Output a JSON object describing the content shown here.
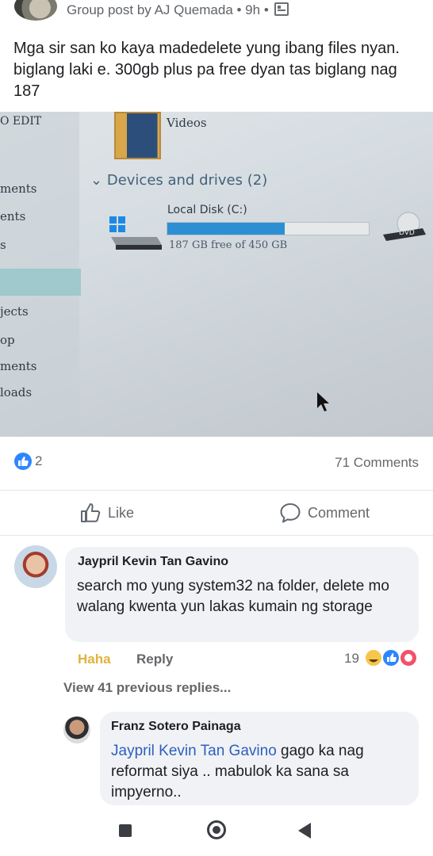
{
  "header": {
    "meta": "Group post by AJ Quemada • 9h •"
  },
  "post": {
    "text": "Mga sir san ko kaya madedelete yung ibang files nyan. biglang laki e. 300gb plus pa free dyan tas biglang nag 187"
  },
  "photo": {
    "edit_label": "O EDIT",
    "side_labels": [
      "ments",
      "ents",
      "s",
      "jects",
      "op",
      "ments",
      "loads"
    ],
    "videos_label": "Videos",
    "devices_heading": "Devices and drives (2)",
    "disk_name": "Local Disk (C:)",
    "disk_free": "187 GB free of 450 GB",
    "disk_used_fraction": 0.584,
    "dvd_label": "DVD"
  },
  "reactions": {
    "like_count": "2",
    "comments_count": "71 Comments"
  },
  "actions": {
    "like_label": "Like",
    "comment_label": "Comment"
  },
  "comment1": {
    "name": "Jaypril Kevin Tan Gavino",
    "text": "search mo yung system32 na folder, delete mo walang kwenta yun lakas kumain ng storage",
    "haha_label": "Haha",
    "reply_label": "Reply",
    "reaction_count": "19"
  },
  "view_previous": "View 41 previous replies...",
  "comment2": {
    "name": "Franz Sotero Painaga",
    "mention": "Jaypril Kevin Tan Gavino",
    "text": " gago ka nag reformat siya .. mabulok ka sana sa impyerno.."
  },
  "colors": {
    "accent": "#2d86ff",
    "haha": "#e1b23a",
    "bubble": "#f0f2f5",
    "bar": "#2c8fd4"
  }
}
